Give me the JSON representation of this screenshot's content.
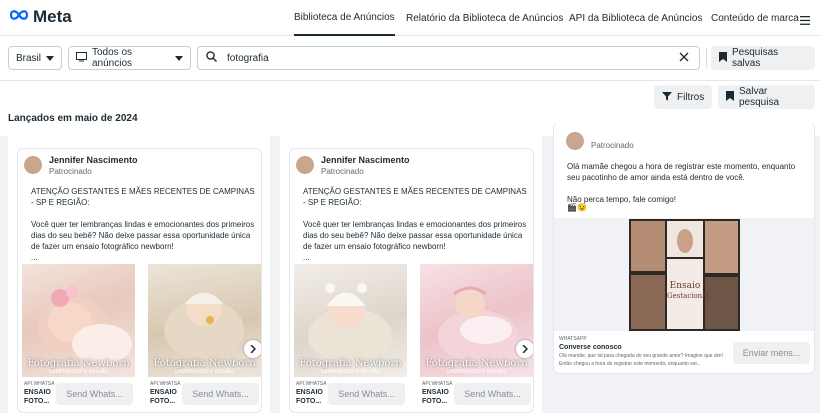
{
  "header": {
    "logo_text": "Meta",
    "nav": [
      {
        "label": "Biblioteca de Anúncios"
      },
      {
        "label": "Relatório da Biblioteca de Anúncios"
      },
      {
        "label": "API da Biblioteca de Anúncios"
      },
      {
        "label": "Conteúdo de marca"
      }
    ]
  },
  "filters": {
    "country": "Brasil",
    "ad_type": "Todos os anúncios",
    "search_value": "fotografia",
    "saved_searches": "Pesquisas salvas",
    "filters_label": "Filtros",
    "save_search_label": "Salvar pesquisa"
  },
  "section_title": "Lançados em maio de 2024",
  "cards": [
    {
      "advertiser": "Jennifer Nascimento",
      "sponsored": "Patrocinado",
      "text": "ATENÇÃO GESTANTES E MÃES RECENTES DE CAMPINAS - SP E REGIÃO:\n\nVocê quer ter lembranças lindas e emocionantes dos primeiros dias do seu bebê? Não deixe passar essa oportunidade única de fazer um ensaio fotográfico newborn!\n...",
      "tiles": [
        {
          "caption": "Fotografia Newborn",
          "sub": "CAMPINAS/SP E REGIÃO",
          "src": "API.WHATSA",
          "title": "ENSAIO FOTO...",
          "cta": "Send Whats..."
        },
        {
          "caption": "Fotografia Newborn",
          "sub": "CAMPINAS/SP E REGIÃO",
          "src": "API.WHATSA",
          "title": "ENSAIO FOTO...",
          "cta": "Send Whats..."
        }
      ]
    },
    {
      "advertiser": "Jennifer Nascimento",
      "sponsored": "Patrocinado",
      "text": "ATENÇÃO GESTANTES E MÃES RECENTES DE CAMPINAS - SP E REGIÃO:\n\nVocê quer ter lembranças lindas e emocionantes dos primeiros dias do seu bebê? Não deixe passar essa oportunidade única de fazer um ensaio fotográfico newborn!\n...",
      "tiles": [
        {
          "caption": "Fotografia Newborn",
          "sub": "CAMPINAS/SP E REGIÃO",
          "src": "API.WHATSA",
          "title": "ENSAIO FOTO...",
          "cta": "Send Whats..."
        },
        {
          "caption": "Fotografia Newborn",
          "sub": "CAMPINAS/SP E REGIÃO",
          "src": "API.WHATSA",
          "title": "ENSAIO FOTO...",
          "cta": "Send Whats..."
        }
      ]
    },
    {
      "sponsored": "Patrocinado",
      "text": "Olá mamãe chegou a hora de registrar este momento, enquanto seu pacotinho de amor ainda está dentro de você.\n\nNão perca tempo, fale comigo!",
      "poster_line1": "Ensaio",
      "poster_line2": "Gestacional",
      "src": "WHATSAPP",
      "cta_title": "Converse conosco",
      "cta_desc": "Olá mamãe, que tal para chegada do seu grande amor? Imagine que sim! Então chegou a hora de registrar este momento, enquanto sei...",
      "cta": "Enviar mens..."
    }
  ]
}
